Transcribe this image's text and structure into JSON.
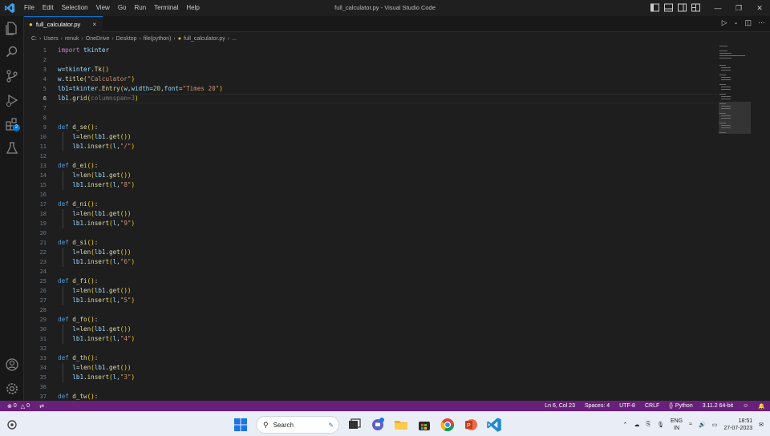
{
  "window": {
    "title": "full_calculator.py - Visual Studio Code",
    "menu": [
      "File",
      "Edit",
      "Selection",
      "View",
      "Go",
      "Run",
      "Terminal",
      "Help"
    ],
    "controls": [
      "minimize-icon",
      "restore-icon",
      "close-icon"
    ]
  },
  "activitybar": {
    "items": [
      "explorer-icon",
      "search-icon",
      "source-control-icon",
      "run-debug-icon",
      "extensions-icon",
      "testing-icon"
    ],
    "extensions_badge": "2",
    "bottom": [
      "account-icon",
      "settings-gear-icon"
    ]
  },
  "tab": {
    "label": "full_calculator.py",
    "close": "×"
  },
  "breadcrumb": [
    "C:",
    "Users",
    "renuk",
    "OneDrive",
    "Desktop",
    "file(python)",
    "full_calculator.py",
    "..."
  ],
  "editor": {
    "lines": [
      {
        "n": "1",
        "t": [
          [
            "kw2",
            "import"
          ],
          [
            "op",
            " "
          ],
          [
            "var",
            "tkinter"
          ]
        ]
      },
      {
        "n": "2",
        "t": []
      },
      {
        "n": "3",
        "t": [
          [
            "var",
            "w"
          ],
          [
            "op",
            "="
          ],
          [
            "var",
            "tkinter"
          ],
          [
            "op",
            "."
          ],
          [
            "fn",
            "Tk"
          ],
          [
            "paren",
            "()"
          ]
        ]
      },
      {
        "n": "4",
        "t": [
          [
            "var",
            "w"
          ],
          [
            "op",
            "."
          ],
          [
            "fn",
            "title"
          ],
          [
            "paren",
            "("
          ],
          [
            "str",
            "\"Calculator\""
          ],
          [
            "paren",
            ")"
          ]
        ]
      },
      {
        "n": "5",
        "t": [
          [
            "var",
            "lb1"
          ],
          [
            "op",
            "="
          ],
          [
            "var",
            "tkinter"
          ],
          [
            "op",
            "."
          ],
          [
            "fn",
            "Entry"
          ],
          [
            "paren",
            "("
          ],
          [
            "var",
            "w"
          ],
          [
            "op",
            ","
          ],
          [
            "var",
            "width"
          ],
          [
            "op",
            "="
          ],
          [
            "num",
            "20"
          ],
          [
            "op",
            ","
          ],
          [
            "var",
            "font"
          ],
          [
            "op",
            "="
          ],
          [
            "str",
            "\"Times 20\""
          ],
          [
            "paren",
            ")"
          ]
        ]
      },
      {
        "n": "6",
        "t": [
          [
            "var",
            "lb1"
          ],
          [
            "op",
            "."
          ],
          [
            "fn",
            "grid"
          ],
          [
            "paren",
            "("
          ],
          [
            "dim",
            "columnspan=3"
          ],
          [
            "paren",
            ")"
          ]
        ]
      },
      {
        "n": "7",
        "t": []
      },
      {
        "n": "8",
        "t": []
      },
      {
        "n": "9",
        "t": [
          [
            "kw",
            "def"
          ],
          [
            "op",
            " "
          ],
          [
            "fn",
            "d_se"
          ],
          [
            "paren",
            "()"
          ],
          [
            "op",
            ":"
          ]
        ]
      },
      {
        "n": "10",
        "t": [
          [
            "op",
            "    "
          ],
          [
            "var",
            "l"
          ],
          [
            "op",
            "="
          ],
          [
            "fn",
            "len"
          ],
          [
            "paren",
            "("
          ],
          [
            "var",
            "lb1"
          ],
          [
            "op",
            "."
          ],
          [
            "fn",
            "get"
          ],
          [
            "paren",
            "())"
          ]
        ]
      },
      {
        "n": "11",
        "t": [
          [
            "op",
            "    "
          ],
          [
            "var",
            "lb1"
          ],
          [
            "op",
            "."
          ],
          [
            "fn",
            "insert"
          ],
          [
            "paren",
            "("
          ],
          [
            "var",
            "l"
          ],
          [
            "op",
            ","
          ],
          [
            "str",
            "\"/\""
          ],
          [
            "paren",
            ")"
          ]
        ]
      },
      {
        "n": "12",
        "t": []
      },
      {
        "n": "13",
        "t": [
          [
            "kw",
            "def"
          ],
          [
            "op",
            " "
          ],
          [
            "fn",
            "d_ei"
          ],
          [
            "paren",
            "()"
          ],
          [
            "op",
            ":"
          ]
        ]
      },
      {
        "n": "14",
        "t": [
          [
            "op",
            "    "
          ],
          [
            "var",
            "l"
          ],
          [
            "op",
            "="
          ],
          [
            "fn",
            "len"
          ],
          [
            "paren",
            "("
          ],
          [
            "var",
            "lb1"
          ],
          [
            "op",
            "."
          ],
          [
            "fn",
            "get"
          ],
          [
            "paren",
            "())"
          ]
        ]
      },
      {
        "n": "15",
        "t": [
          [
            "op",
            "    "
          ],
          [
            "var",
            "lb1"
          ],
          [
            "op",
            "."
          ],
          [
            "fn",
            "insert"
          ],
          [
            "paren",
            "("
          ],
          [
            "var",
            "l"
          ],
          [
            "op",
            ","
          ],
          [
            "str",
            "\"8\""
          ],
          [
            "paren",
            ")"
          ]
        ]
      },
      {
        "n": "16",
        "t": []
      },
      {
        "n": "17",
        "t": [
          [
            "kw",
            "def"
          ],
          [
            "op",
            " "
          ],
          [
            "fn",
            "d_ni"
          ],
          [
            "paren",
            "()"
          ],
          [
            "op",
            ":"
          ]
        ]
      },
      {
        "n": "18",
        "t": [
          [
            "op",
            "    "
          ],
          [
            "var",
            "l"
          ],
          [
            "op",
            "="
          ],
          [
            "fn",
            "len"
          ],
          [
            "paren",
            "("
          ],
          [
            "var",
            "lb1"
          ],
          [
            "op",
            "."
          ],
          [
            "fn",
            "get"
          ],
          [
            "paren",
            "())"
          ]
        ]
      },
      {
        "n": "19",
        "t": [
          [
            "op",
            "    "
          ],
          [
            "var",
            "lb1"
          ],
          [
            "op",
            "."
          ],
          [
            "fn",
            "insert"
          ],
          [
            "paren",
            "("
          ],
          [
            "var",
            "l"
          ],
          [
            "op",
            ","
          ],
          [
            "str",
            "\"9\""
          ],
          [
            "paren",
            ")"
          ]
        ]
      },
      {
        "n": "20",
        "t": []
      },
      {
        "n": "21",
        "t": [
          [
            "kw",
            "def"
          ],
          [
            "op",
            " "
          ],
          [
            "fn",
            "d_si"
          ],
          [
            "paren",
            "()"
          ],
          [
            "op",
            ":"
          ]
        ]
      },
      {
        "n": "22",
        "t": [
          [
            "op",
            "    "
          ],
          [
            "var",
            "l"
          ],
          [
            "op",
            "="
          ],
          [
            "fn",
            "len"
          ],
          [
            "paren",
            "("
          ],
          [
            "var",
            "lb1"
          ],
          [
            "op",
            "."
          ],
          [
            "fn",
            "get"
          ],
          [
            "paren",
            "())"
          ]
        ]
      },
      {
        "n": "23",
        "t": [
          [
            "op",
            "    "
          ],
          [
            "var",
            "lb1"
          ],
          [
            "op",
            "."
          ],
          [
            "fn",
            "insert"
          ],
          [
            "paren",
            "("
          ],
          [
            "var",
            "l"
          ],
          [
            "op",
            ","
          ],
          [
            "str",
            "\"6\""
          ],
          [
            "paren",
            ")"
          ]
        ]
      },
      {
        "n": "24",
        "t": []
      },
      {
        "n": "25",
        "t": [
          [
            "kw",
            "def"
          ],
          [
            "op",
            " "
          ],
          [
            "fn",
            "d_fi"
          ],
          [
            "paren",
            "()"
          ],
          [
            "op",
            ":"
          ]
        ]
      },
      {
        "n": "26",
        "t": [
          [
            "op",
            "    "
          ],
          [
            "var",
            "l"
          ],
          [
            "op",
            "="
          ],
          [
            "fn",
            "len"
          ],
          [
            "paren",
            "("
          ],
          [
            "var",
            "lb1"
          ],
          [
            "op",
            "."
          ],
          [
            "fn",
            "get"
          ],
          [
            "paren",
            "())"
          ]
        ]
      },
      {
        "n": "27",
        "t": [
          [
            "op",
            "    "
          ],
          [
            "var",
            "lb1"
          ],
          [
            "op",
            "."
          ],
          [
            "fn",
            "insert"
          ],
          [
            "paren",
            "("
          ],
          [
            "var",
            "l"
          ],
          [
            "op",
            ","
          ],
          [
            "str",
            "\"5\""
          ],
          [
            "paren",
            ")"
          ]
        ]
      },
      {
        "n": "28",
        "t": []
      },
      {
        "n": "29",
        "t": [
          [
            "kw",
            "def"
          ],
          [
            "op",
            " "
          ],
          [
            "fn",
            "d_fo"
          ],
          [
            "paren",
            "()"
          ],
          [
            "op",
            ":"
          ]
        ]
      },
      {
        "n": "30",
        "t": [
          [
            "op",
            "    "
          ],
          [
            "var",
            "l"
          ],
          [
            "op",
            "="
          ],
          [
            "fn",
            "len"
          ],
          [
            "paren",
            "("
          ],
          [
            "var",
            "lb1"
          ],
          [
            "op",
            "."
          ],
          [
            "fn",
            "get"
          ],
          [
            "paren",
            "())"
          ]
        ]
      },
      {
        "n": "31",
        "t": [
          [
            "op",
            "    "
          ],
          [
            "var",
            "lb1"
          ],
          [
            "op",
            "."
          ],
          [
            "fn",
            "insert"
          ],
          [
            "paren",
            "("
          ],
          [
            "var",
            "l"
          ],
          [
            "op",
            ","
          ],
          [
            "str",
            "\"4\""
          ],
          [
            "paren",
            ")"
          ]
        ]
      },
      {
        "n": "32",
        "t": []
      },
      {
        "n": "33",
        "t": [
          [
            "kw",
            "def"
          ],
          [
            "op",
            " "
          ],
          [
            "fn",
            "d_th"
          ],
          [
            "paren",
            "()"
          ],
          [
            "op",
            ":"
          ]
        ]
      },
      {
        "n": "34",
        "t": [
          [
            "op",
            "    "
          ],
          [
            "var",
            "l"
          ],
          [
            "op",
            "="
          ],
          [
            "fn",
            "len"
          ],
          [
            "paren",
            "("
          ],
          [
            "var",
            "lb1"
          ],
          [
            "op",
            "."
          ],
          [
            "fn",
            "get"
          ],
          [
            "paren",
            "())"
          ]
        ]
      },
      {
        "n": "35",
        "t": [
          [
            "op",
            "    "
          ],
          [
            "var",
            "lb1"
          ],
          [
            "op",
            "."
          ],
          [
            "fn",
            "insert"
          ],
          [
            "paren",
            "("
          ],
          [
            "var",
            "l"
          ],
          [
            "op",
            ","
          ],
          [
            "str",
            "\"3\""
          ],
          [
            "paren",
            ")"
          ]
        ]
      },
      {
        "n": "36",
        "t": []
      },
      {
        "n": "37",
        "t": [
          [
            "kw",
            "def"
          ],
          [
            "op",
            " "
          ],
          [
            "fn",
            "d_tw"
          ],
          [
            "paren",
            "()"
          ],
          [
            "op",
            ":"
          ]
        ]
      }
    ],
    "current_line": "6"
  },
  "statusbar": {
    "errors": "0",
    "warnings": "0",
    "position": "Ln 6, Col 23",
    "spaces": "Spaces: 4",
    "encoding": "UTF-8",
    "eol": "CRLF",
    "language": "Python",
    "interpreter": "3.11.2 64-bit"
  },
  "taskbar": {
    "search_placeholder": "Search",
    "lang_top": "ENG",
    "lang_bottom": "IN",
    "time": "18:51",
    "date": "27-07-2023"
  },
  "colors": {
    "statusbar": "#68217a",
    "accent": "#0078d4"
  }
}
